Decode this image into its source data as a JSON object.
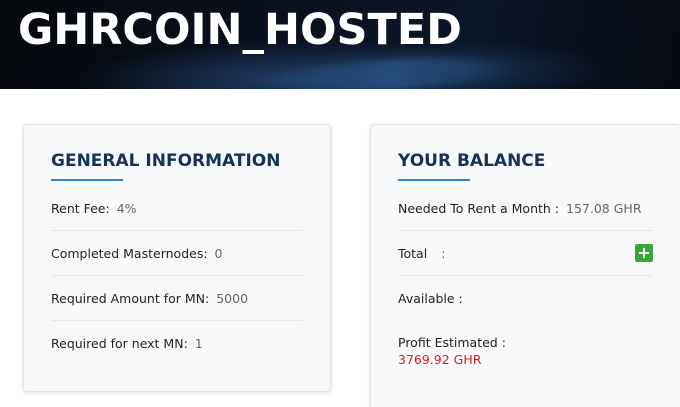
{
  "banner": {
    "title": "GHRCOIN_HOSTED"
  },
  "general": {
    "title": "GENERAL INFORMATION",
    "rows": [
      {
        "label": "Rent Fee:",
        "value": "4%"
      },
      {
        "label": "Completed Masternodes:",
        "value": "0"
      },
      {
        "label": "Required Amount for MN:",
        "value": "5000"
      },
      {
        "label": "Required for next MN:",
        "value": "1"
      }
    ]
  },
  "balance": {
    "title": "YOUR BALANCE",
    "needed_label": "Needed To Rent a Month :",
    "needed_value": "157.08 GHR",
    "total_label": "Total",
    "total_sep": ":",
    "add_icon": "plus-icon",
    "available_label": "Available :",
    "profit_label": "Profit Estimated :",
    "profit_value": "3769.92 GHR"
  },
  "colors": {
    "title": "#15335a",
    "accent": "#2b82c9",
    "profit": "#e0191f",
    "add_button": "#3aa537"
  }
}
